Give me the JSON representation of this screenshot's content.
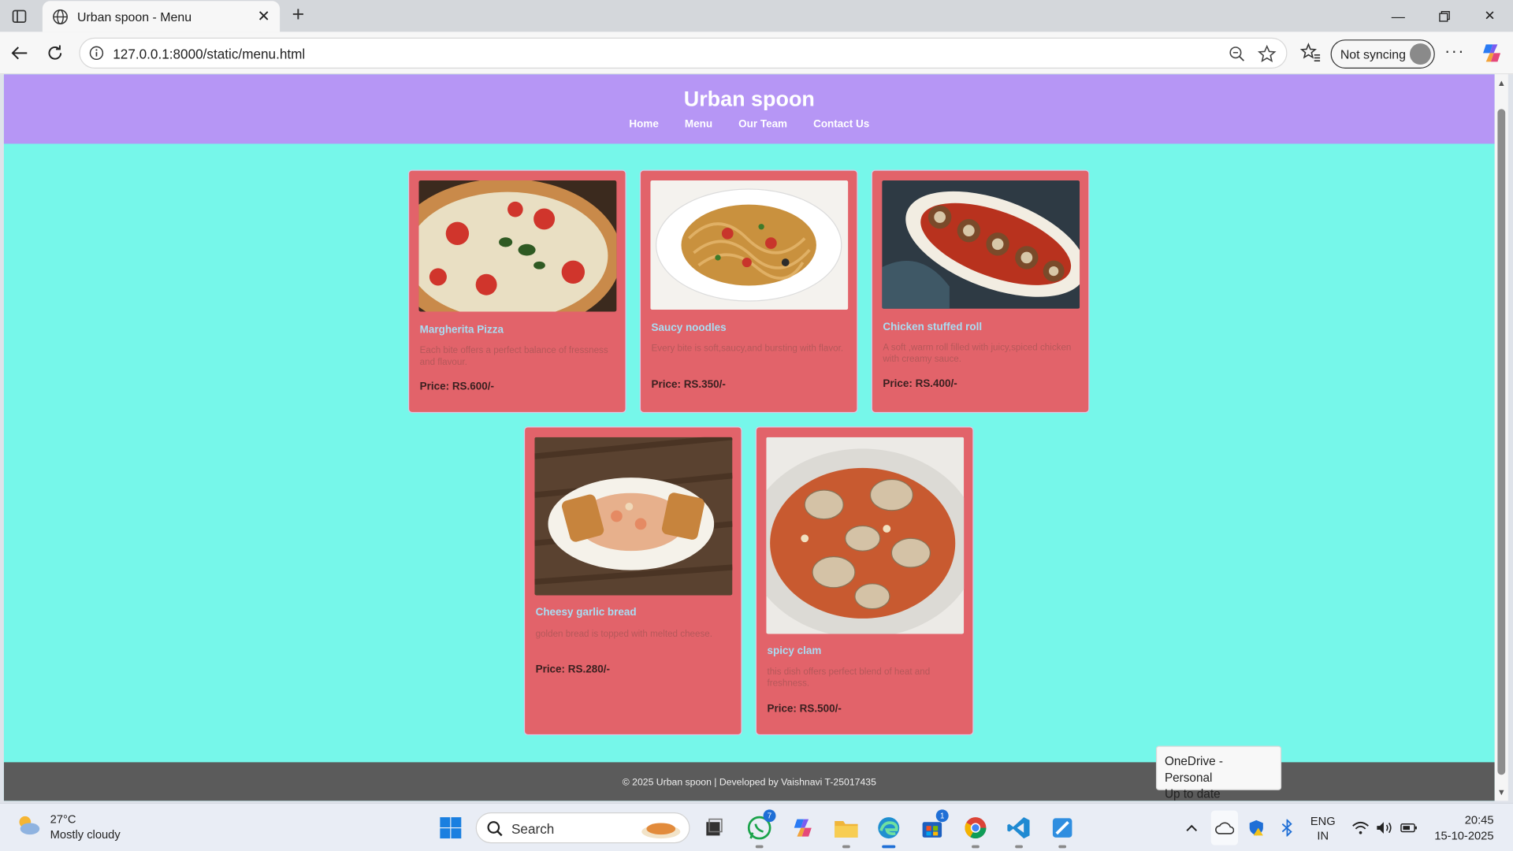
{
  "browser": {
    "tab_title": "Urban spoon - Menu",
    "url": "127.0.0.1:8000/static/menu.html",
    "sync_label": "Not syncing"
  },
  "site": {
    "title": "Urban spoon",
    "nav": [
      "Home",
      "Menu",
      "Our Team",
      "Contact Us"
    ],
    "footer": "© 2025 Urban spoon | Developed by Vaishnavi T-25017435"
  },
  "menu": [
    {
      "name": "Margherita Pizza",
      "desc": "Each bite offers a perfect balance of fressness and flavour.",
      "price": "Price: RS.600/-"
    },
    {
      "name": "Saucy noodles",
      "desc": "Every bite is soft,saucy,and bursting with flavor.",
      "price": "Price: RS.350/-"
    },
    {
      "name": "Chicken stuffed roll",
      "desc": "A soft ,warm roll filled with juicy,spiced chicken with creamy sauce.",
      "price": "Price: RS.400/-"
    },
    {
      "name": "Cheesy garlic bread",
      "desc": "golden bread is topped with melted cheese.",
      "price": "Price: RS.280/-"
    },
    {
      "name": "spicy clam",
      "desc": "this dish offers perfect blend of heat and freshness.",
      "price": "Price: RS.500/-"
    }
  ],
  "notification": {
    "title": "OneDrive - Personal",
    "status": "Up to date"
  },
  "taskbar": {
    "temperature": "27°C",
    "weather": "Mostly cloudy",
    "search_label": "Search",
    "whatsapp_badge": "7",
    "store_badge": "1",
    "lang": "ENG",
    "region": "IN",
    "time": "20:45",
    "date": "15-10-2025"
  }
}
